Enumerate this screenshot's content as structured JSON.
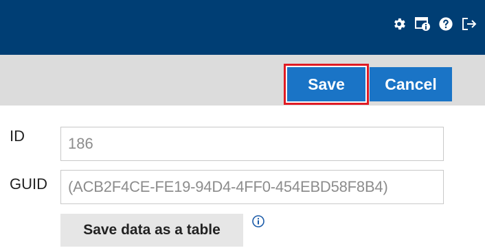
{
  "header": {
    "background": "#003e74",
    "icons": [
      "gear-icon",
      "window-info-icon",
      "help-icon",
      "logout-icon"
    ]
  },
  "toolbar": {
    "save_label": "Save",
    "cancel_label": "Cancel",
    "button_color": "#1a74c6",
    "highlight_color": "#e01b24"
  },
  "form": {
    "id_label": "ID",
    "id_value": "186",
    "guid_label": "GUID",
    "guid_value": "(ACB2F4CE-FE19-94D4-4FF0-454EBD58F8B4)",
    "save_table_label": "Save data as a table",
    "info_icon": "info-icon"
  }
}
